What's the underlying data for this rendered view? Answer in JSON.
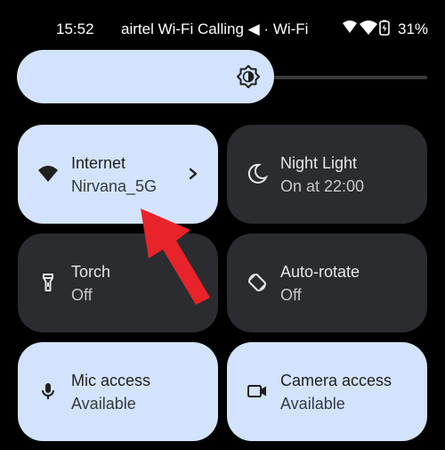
{
  "status_bar": {
    "time": "15:52",
    "carrier": "airtel Wi-Fi Calling ◀ · Wi-Fi",
    "battery": "31%"
  },
  "brightness": {
    "icon": "brightness-icon"
  },
  "tiles": [
    {
      "title": "Internet",
      "subtitle": "Nirvana_5G",
      "icon": "wifi-icon",
      "state": "on"
    },
    {
      "title": "Night Light",
      "subtitle": "On at 22:00",
      "icon": "moon-icon",
      "state": "off"
    },
    {
      "title": "Torch",
      "subtitle": "Off",
      "icon": "torch-icon",
      "state": "off"
    },
    {
      "title": "Auto-rotate",
      "subtitle": "Off",
      "icon": "rotate-icon",
      "state": "off"
    },
    {
      "title": "Mic access",
      "subtitle": "Available",
      "icon": "mic-icon",
      "state": "on"
    },
    {
      "title": "Camera access",
      "subtitle": "Available",
      "icon": "camera-icon",
      "state": "on"
    }
  ],
  "colors": {
    "tile_on": "#d3e3fd",
    "tile_off": "#2b2c2f",
    "annotation_arrow": "#e8232a"
  }
}
